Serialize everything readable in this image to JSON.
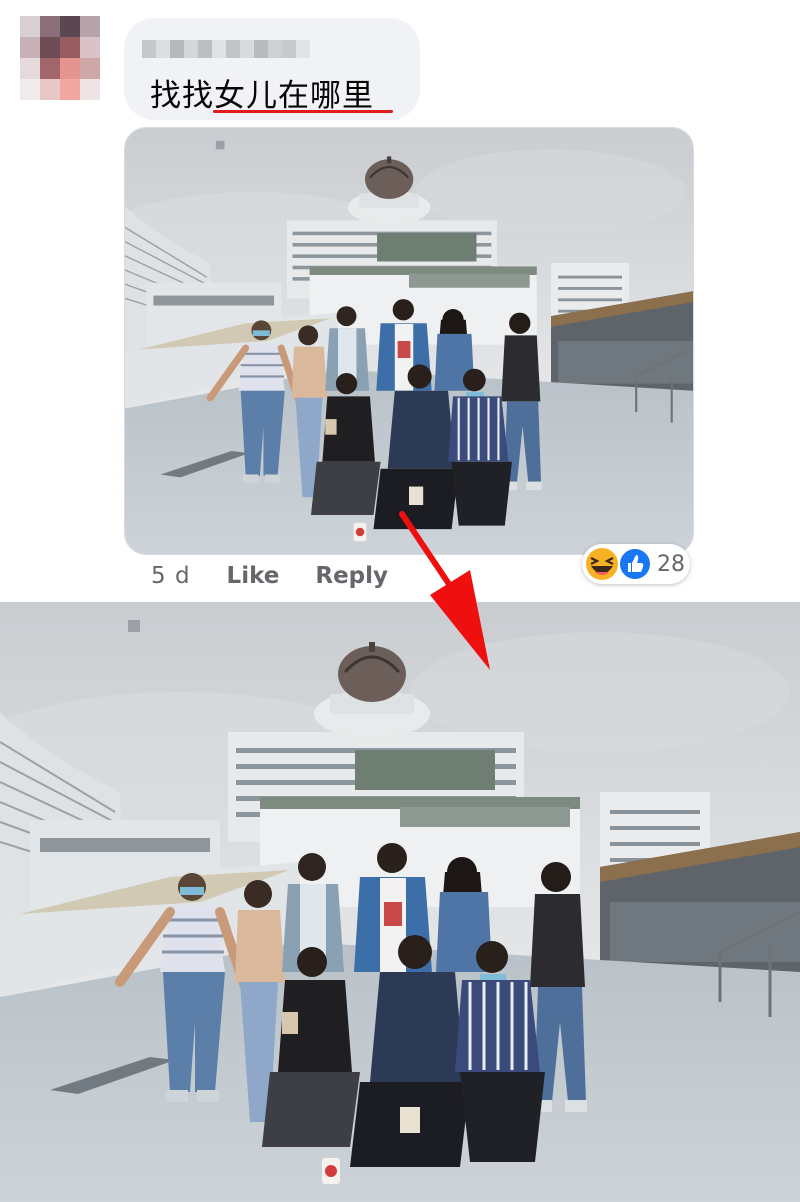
{
  "comment": {
    "text": "找找女儿在哪里",
    "time": "5 d",
    "like_label": "Like",
    "reply_label": "Reply",
    "reaction_count": "28",
    "reaction_icons": [
      "haha-emoji-icon",
      "like-thumb-icon"
    ]
  },
  "colors": {
    "bubble": "#f0f2f5",
    "annotation_red": "#e21b1b",
    "like_blue": "#1877f2",
    "meta_gray": "#65676b"
  }
}
